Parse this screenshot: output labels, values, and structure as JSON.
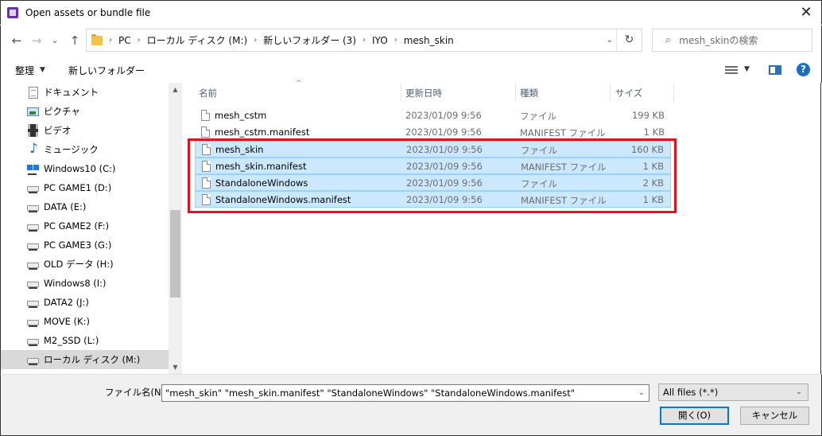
{
  "window": {
    "title": "Open assets or bundle file",
    "close_glyph": "✕"
  },
  "nav": {
    "back": "←",
    "forward": "→",
    "recent": "⌄",
    "up": "↑"
  },
  "breadcrumb": {
    "items": [
      "PC",
      "ローカル ディスク (M:)",
      "新しいフォルダー (3)",
      "IYO",
      "mesh_skin"
    ],
    "separator": "›",
    "refresh": "↻"
  },
  "search": {
    "placeholder": "mesh_skinの検索",
    "icon": "⌕"
  },
  "toolbar": {
    "organize": "整理",
    "organize_caret": "▼",
    "new_folder": "新しいフォルダー",
    "view_caret": "▼",
    "help": "?"
  },
  "sidebar": {
    "items": [
      {
        "label": "ドキュメント",
        "icon": "documents-icon"
      },
      {
        "label": "ピクチャ",
        "icon": "pictures-icon"
      },
      {
        "label": "ビデオ",
        "icon": "videos-icon"
      },
      {
        "label": "ミュージック",
        "icon": "music-icon"
      },
      {
        "label": "Windows10 (C:)",
        "icon": "windows-drive-icon"
      },
      {
        "label": "PC GAME1 (D:)",
        "icon": "drive-icon"
      },
      {
        "label": "DATA (E:)",
        "icon": "drive-icon"
      },
      {
        "label": "PC GAME2 (F:)",
        "icon": "drive-icon"
      },
      {
        "label": "PC GAME3 (G:)",
        "icon": "drive-icon"
      },
      {
        "label": "OLD データ (H:)",
        "icon": "drive-icon"
      },
      {
        "label": "Windows8 (I:)",
        "icon": "drive-icon"
      },
      {
        "label": "DATA2 (J:)",
        "icon": "drive-icon"
      },
      {
        "label": "MOVE (K:)",
        "icon": "drive-icon"
      },
      {
        "label": "M2_SSD (L:)",
        "icon": "drive-icon"
      },
      {
        "label": "ローカル ディスク (M:)",
        "icon": "drive-icon",
        "selected": true
      }
    ]
  },
  "columns": {
    "name": "名前",
    "date": "更新日時",
    "type": "種類",
    "size": "サイズ",
    "sort_glyph": "^"
  },
  "files": [
    {
      "name": "mesh_cstm",
      "date": "2023/01/09 9:56",
      "type": "ファイル",
      "size": "199 KB",
      "selected": false
    },
    {
      "name": "mesh_cstm.manifest",
      "date": "2023/01/09 9:56",
      "type": "MANIFEST ファイル",
      "size": "1 KB",
      "selected": false
    },
    {
      "name": "mesh_skin",
      "date": "2023/01/09 9:56",
      "type": "ファイル",
      "size": "160 KB",
      "selected": true
    },
    {
      "name": "mesh_skin.manifest",
      "date": "2023/01/09 9:56",
      "type": "MANIFEST ファイル",
      "size": "1 KB",
      "selected": true
    },
    {
      "name": "StandaloneWindows",
      "date": "2023/01/09 9:56",
      "type": "ファイル",
      "size": "2 KB",
      "selected": true
    },
    {
      "name": "StandaloneWindows.manifest",
      "date": "2023/01/09 9:56",
      "type": "MANIFEST ファイル",
      "size": "1 KB",
      "selected": true
    }
  ],
  "footer": {
    "filename_label": "ファイル名(N):",
    "filename_value": "\"mesh_skin\" \"mesh_skin.manifest\" \"StandaloneWindows\" \"StandaloneWindows.manifest\"",
    "filter": "All files (*.*)",
    "dropdown_caret": "⌄",
    "open": "開く(O)",
    "cancel": "キャンセル"
  },
  "scroll": {
    "up": "▲",
    "down": "▼"
  },
  "colors": {
    "selection": "#cce8ff",
    "highlight_border": "#e0141f",
    "accent": "#0078d7"
  }
}
